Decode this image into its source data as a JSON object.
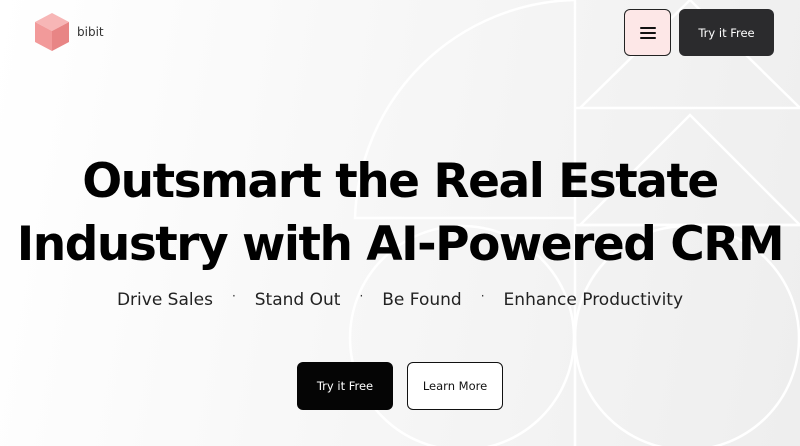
{
  "brand": {
    "name": "bibit"
  },
  "header": {
    "cta_label": "Try it Free",
    "menu_icon": "hamburger-icon"
  },
  "hero": {
    "title_line1": "Outsmart the Real Estate",
    "title_line2": "Industry with AI-Powered CRM",
    "features": [
      "Drive Sales",
      "Stand Out",
      "Be Found",
      "Enhance Productivity"
    ],
    "separator": "·",
    "primary_cta": "Try it Free",
    "secondary_cta": "Learn More"
  },
  "colors": {
    "logo": "#f29a9a",
    "menu_button_bg": "#fde7e7",
    "dark_button": "#2b2b2d",
    "primary_button": "#050505"
  }
}
